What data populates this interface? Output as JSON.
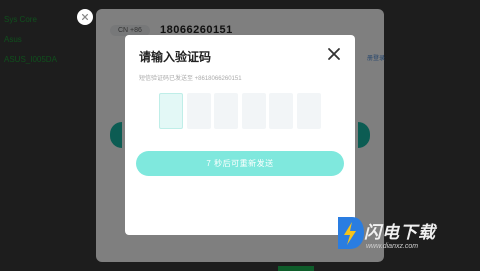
{
  "system_info": {
    "lines": [
      "Sys Core",
      "Asus",
      "ASUS_I005DA"
    ]
  },
  "login_card": {
    "country_code": "CN +86",
    "phone": "18066260151",
    "side_link": "册登录"
  },
  "dialog": {
    "title": "请输入验证码",
    "subtitle": "短信验证码已发送至 +8618066260151",
    "code_boxes": [
      "",
      "",
      "",
      "",
      "",
      ""
    ],
    "resend_button": "7 秒后可重新发送"
  },
  "watermark": {
    "brand": "闪电下载",
    "url": "www.dianxz.com"
  },
  "colors": {
    "accent": "#19b8a6",
    "resend_button": "#7fe8dd",
    "sysinfo_text": "#1f9d3a"
  }
}
